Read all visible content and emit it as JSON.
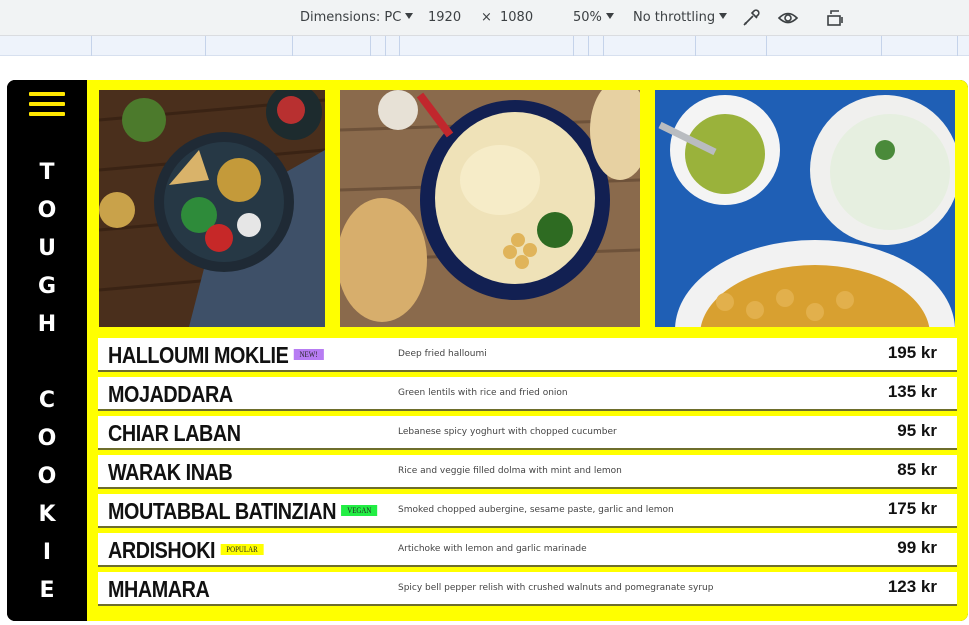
{
  "devtools": {
    "dimensions_label": "Dimensions: PC",
    "width": "1920",
    "times": "×",
    "height": "1080",
    "zoom": "50%",
    "throttling": "No throttling",
    "icons": [
      "eyedropper-icon",
      "eye-icon",
      "rotate-icon"
    ]
  },
  "sidebar": {
    "menu_icon": "hamburger-menu-icon",
    "brand_letters": [
      "T",
      "O",
      "U",
      "G",
      "H",
      "",
      "C",
      "O",
      "O",
      "K",
      "I",
      "E"
    ]
  },
  "photos": [
    "salad-bowl-photo",
    "hummus-plate-photo",
    "dips-bowls-photo"
  ],
  "menu": {
    "items": [
      {
        "name": "HALLOUMI MOKLIE",
        "badge": "NEW!",
        "badge_color": "#b77cf3",
        "description": "Deep fried halloumi",
        "price": "195 kr"
      },
      {
        "name": "MOJADDARA",
        "badge": "",
        "badge_color": "",
        "description": "Green lentils with rice and fried onion",
        "price": "135 kr"
      },
      {
        "name": "CHIAR LABAN",
        "badge": "",
        "badge_color": "",
        "description": "Lebanese spicy yoghurt with chopped cucumber",
        "price": "95 kr"
      },
      {
        "name": "WARAK INAB",
        "badge": "",
        "badge_color": "",
        "description": "Rice  and veggie filled dolma with mint and lemon",
        "price": "85 kr"
      },
      {
        "name": "MOUTABBAL BATINZIAN",
        "badge": "VEGAN",
        "badge_color": "#22ee44",
        "description": "Smoked chopped aubergine, sesame paste, garlic and lemon",
        "price": "175 kr"
      },
      {
        "name": "ARDISHOKI",
        "badge": "POPULAR",
        "badge_color": "#ffff00",
        "description": "Artichoke with lemon and garlic marinade",
        "price": "99 kr"
      },
      {
        "name": "MHAMARA",
        "badge": "",
        "badge_color": "",
        "description": "Spicy bell pepper relish with crushed walnuts and pomegranate syrup",
        "price": "123 kr"
      }
    ]
  },
  "colors": {
    "accent": "#ffff00",
    "sidebar": "#000000"
  }
}
